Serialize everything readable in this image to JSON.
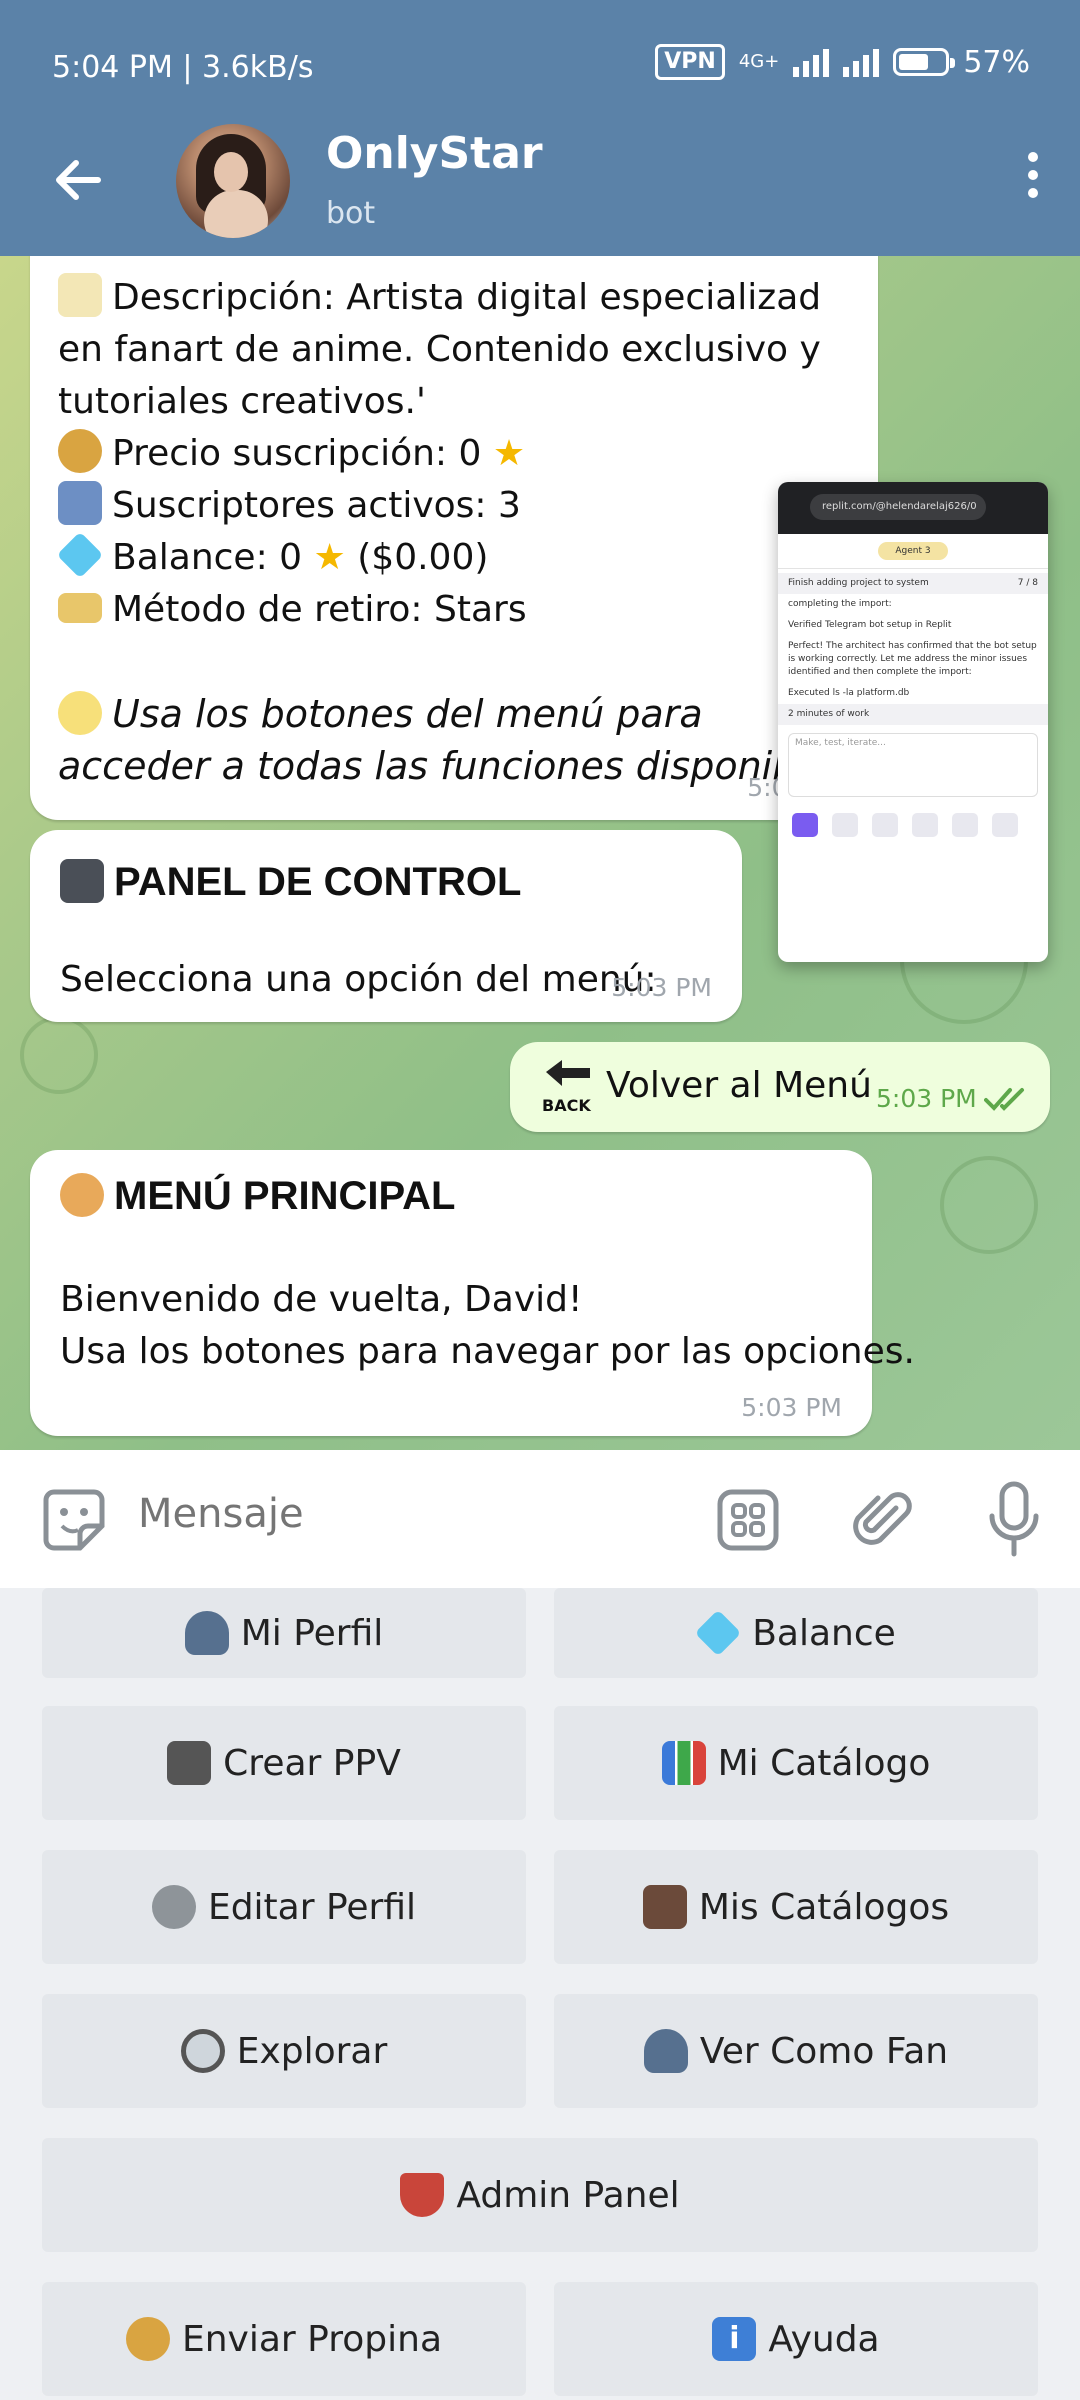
{
  "status_bar": {
    "time": "5:04 PM | 3.6kB/s",
    "vpn": "VPN",
    "network": "4G+",
    "battery": "57%",
    "battery_level": 0.57
  },
  "header": {
    "title": "OnlyStar",
    "subtitle": "bot"
  },
  "messages": {
    "profile": {
      "lines": [
        "Descripción: Artista digital especializad",
        "en fanart de anime. Contenido exclusivo y",
        "tutoriales creativos.'",
        "Precio suscripción: 0",
        "Suscriptores activos: 3",
        "Balance: 0",
        "($0.00)",
        "Método de retiro: Stars"
      ],
      "tip_line1": "Usa los botones del menú para",
      "tip_line2": "acceder a todas las funciones disponibles.",
      "time": "5:03 PM"
    },
    "control": {
      "title": "PANEL DE CONTROL",
      "body": "Selecciona una opción del menú:",
      "time": "5:03 PM"
    },
    "outgoing": {
      "text": "Volver al Menú",
      "back_icon_label": "BACK",
      "time": "5:03 PM"
    },
    "menu": {
      "title": "MENÚ PRINCIPAL",
      "line1": "Bienvenido de vuelta, David!",
      "line2": "Usa los botones para navegar por las opciones.",
      "time": "5:03 PM"
    }
  },
  "overlay": {
    "url": "replit.com/@helendarelaj626/0",
    "agent": "Agent 3",
    "task": "Finish adding project to system",
    "task_count": "7 / 8",
    "partial": "completing the import:",
    "verified": "Verified Telegram bot setup in Replit",
    "summary": "Perfect! The architect has confirmed that the bot setup is working correctly. Let me address the minor issues identified and then complete the import:",
    "executed": "Executed ls -la platform.db",
    "work_time": "2 minutes of work",
    "input_placeholder": "Make, test, iterate..."
  },
  "input": {
    "placeholder": "Mensaje"
  },
  "keyboard": {
    "mi_perfil": "Mi Perfil",
    "balance": "Balance",
    "crear_ppv": "Crear PPV",
    "mi_catalogo": "Mi Catálogo",
    "editar_perfil": "Editar Perfil",
    "mis_catalogos": "Mis Catálogos",
    "explorar": "Explorar",
    "ver_como_fan": "Ver Como Fan",
    "admin_panel": "Admin Panel",
    "enviar_propina": "Enviar Propina",
    "ayuda": "Ayuda"
  },
  "colors": {
    "header": "#5b82a8",
    "outgoing_bubble": "#effedd",
    "keyboard_button": "#e4e7eb"
  }
}
